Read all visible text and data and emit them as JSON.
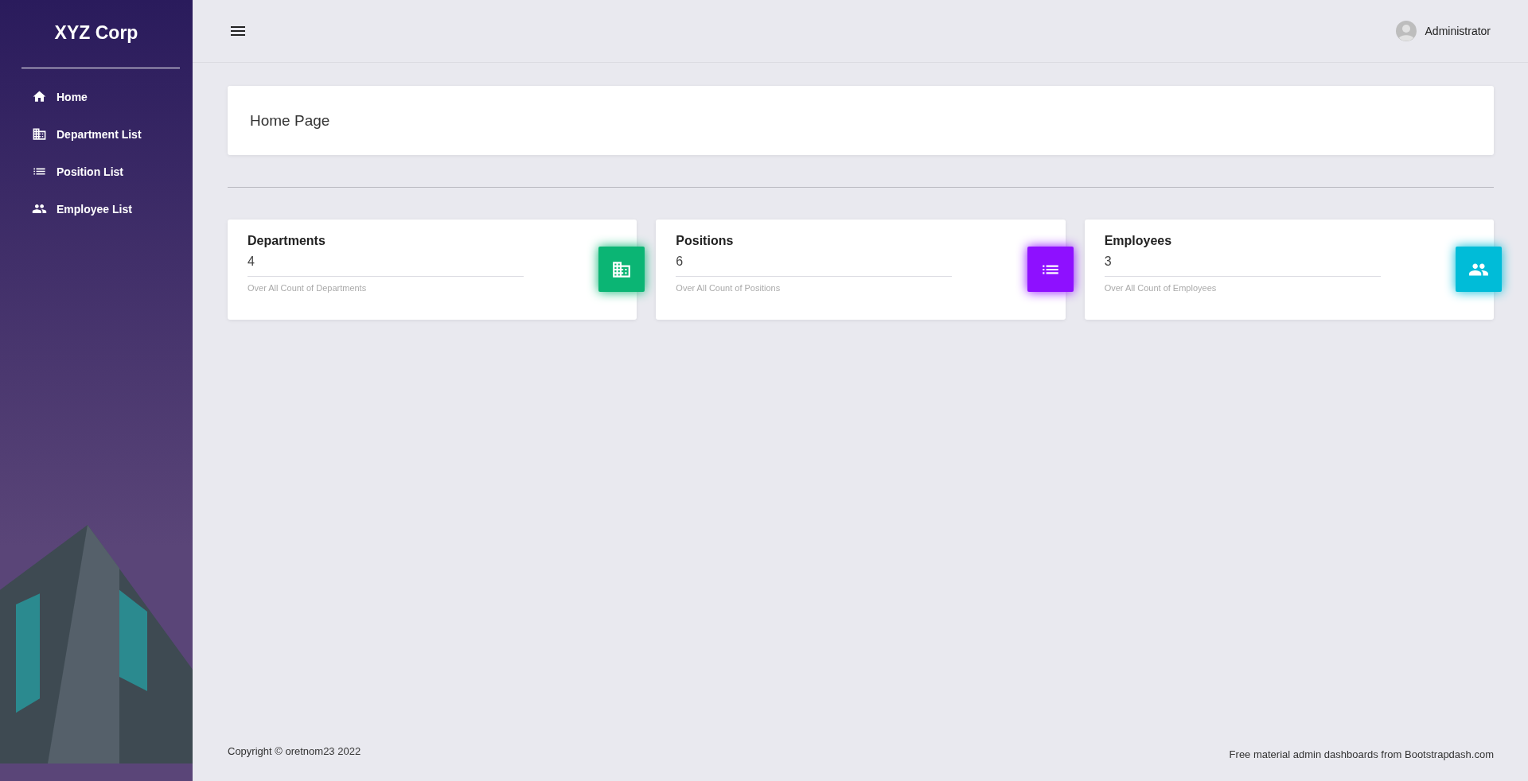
{
  "sidebar": {
    "brand": "XYZ Corp",
    "items": [
      {
        "label": "Home"
      },
      {
        "label": "Department List"
      },
      {
        "label": "Position List"
      },
      {
        "label": "Employee List"
      }
    ]
  },
  "topbar": {
    "user": "Administrator"
  },
  "page_title": "Home Page",
  "stats": [
    {
      "title": "Departments",
      "value": "4",
      "caption": "Over All Count of Departments",
      "color": "#0bb574"
    },
    {
      "title": "Positions",
      "value": "6",
      "caption": "Over All Count of Positions",
      "color": "#8e10ff"
    },
    {
      "title": "Employees",
      "value": "3",
      "caption": "Over All Count of Employees",
      "color": "#00bcd8"
    }
  ],
  "footer": {
    "copyright": "Copyright © oretnom23 2022",
    "credit": "Free material admin dashboards from Bootstrapdash.com"
  }
}
